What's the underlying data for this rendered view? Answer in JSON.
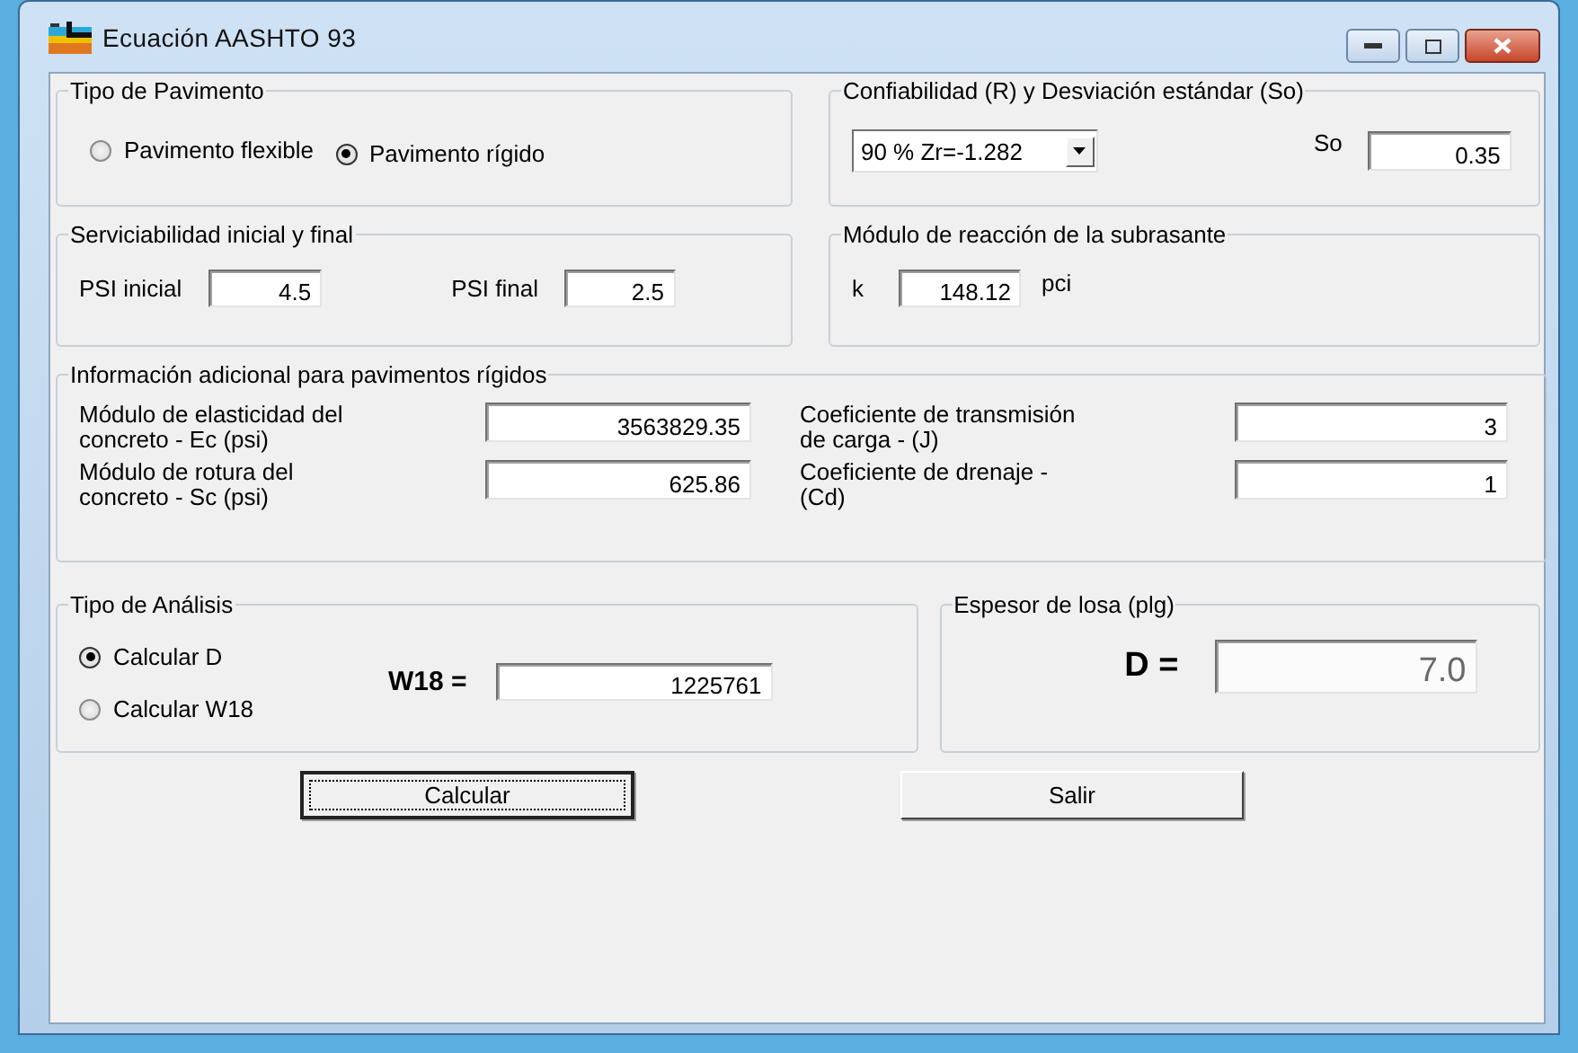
{
  "window": {
    "title": "Ecuación AASHTO 93"
  },
  "pavement_type": {
    "title": "Tipo de Pavimento",
    "options": [
      {
        "label": "Pavimento flexible",
        "selected": false
      },
      {
        "label": "Pavimento rígido",
        "selected": true
      }
    ]
  },
  "reliability": {
    "title": "Confiabilidad (R) y Desviación estándar (So)",
    "dropdown": {
      "value": "90 % Zr=-1.282"
    },
    "so": {
      "label": "So",
      "value": "0.35"
    }
  },
  "serviceability": {
    "title": "Serviciabilidad inicial y final",
    "fields": [
      {
        "label": "PSI inicial",
        "value": "4.5"
      },
      {
        "label": "PSI final",
        "value": "2.5"
      }
    ]
  },
  "subgrade": {
    "title": "Módulo de reacción de la subrasante",
    "field": {
      "label": "k",
      "value": "148.12",
      "unit": "pci"
    }
  },
  "rigid_info": {
    "title": "Información adicional para pavimentos rígidos",
    "fields": [
      {
        "label": "Módulo de elasticidad del concreto - Ec (psi)",
        "value": "3563829.35"
      },
      {
        "label": "Coeficiente de transmisión de carga - (J)",
        "value": "3"
      },
      {
        "label": "Módulo de rotura del concreto - Sc (psi)",
        "value": "625.86"
      },
      {
        "label": "Coeficiente de drenaje - (Cd)",
        "value": "1"
      }
    ]
  },
  "analysis_type": {
    "title": "Tipo de Análisis",
    "options": [
      {
        "label": "Calcular D",
        "selected": true
      },
      {
        "label": "Calcular W18",
        "selected": false
      }
    ],
    "w18": {
      "label": "W18 =",
      "value": "1225761"
    }
  },
  "slab_thickness": {
    "title": "Espesor de losa (plg)",
    "d": {
      "label": "D =",
      "value": "7.0",
      "disabled": true
    }
  },
  "buttons": [
    {
      "label": "Calcular",
      "focused": true
    },
    {
      "label": "Salir",
      "focused": false
    }
  ]
}
